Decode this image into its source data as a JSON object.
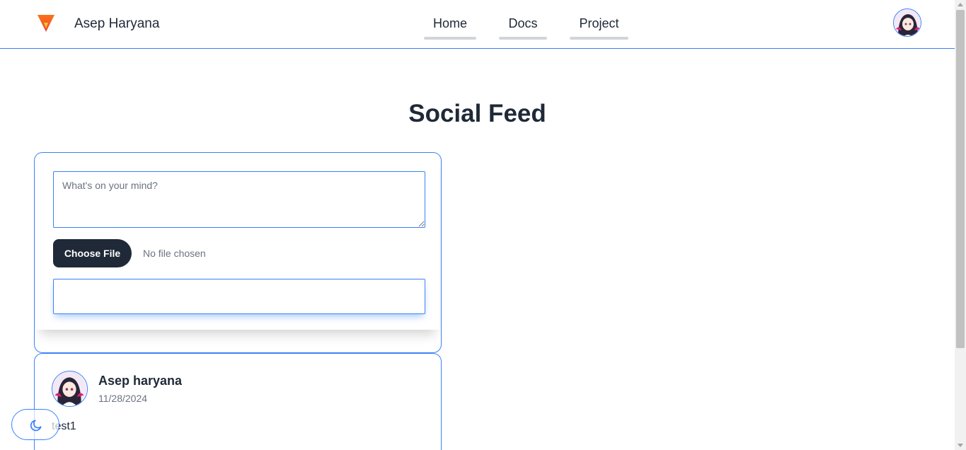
{
  "header": {
    "brand_name": "Asep Haryana",
    "logo_icon": "triangle-logo-icon",
    "nav": [
      {
        "label": "Home"
      },
      {
        "label": "Docs"
      },
      {
        "label": "Project"
      }
    ],
    "avatar_icon": "user-avatar-icon"
  },
  "main": {
    "title": "Social Feed",
    "composer": {
      "placeholder": "What's on your mind?",
      "value": "",
      "file_button_label": "Choose File",
      "file_status": "No file chosen",
      "submit_label": ""
    },
    "posts": [
      {
        "author": "Asep haryana",
        "date": "11/28/2024",
        "text": "test1"
      }
    ]
  },
  "theme_toggle": {
    "icon": "moon-icon"
  },
  "colors": {
    "accent": "#3b82f6",
    "text": "#1f2937",
    "muted": "#6b7280",
    "dark_button": "#1f2937",
    "logo_orange": "#f97316",
    "logo_yellow": "#facc15"
  }
}
